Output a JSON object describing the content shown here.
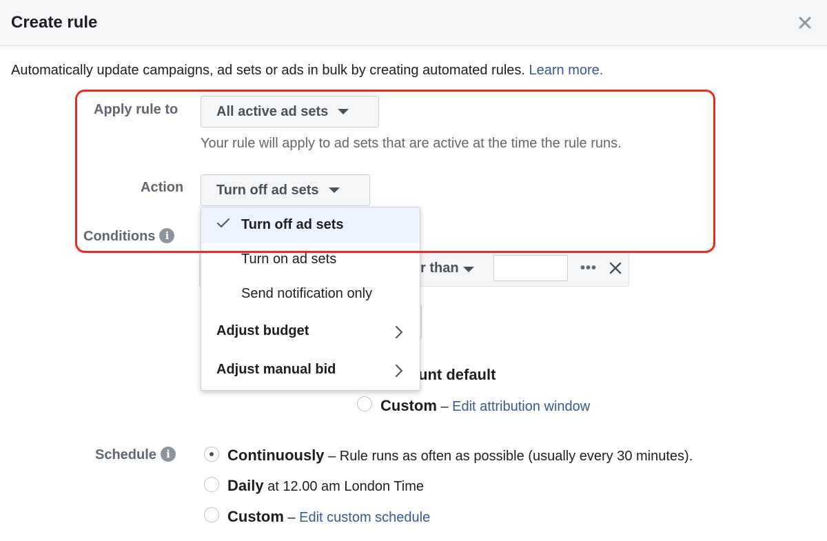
{
  "dialog": {
    "title": "Create rule",
    "intro_text": "Automatically update campaigns, ad sets or ads in bulk by creating automated rules.",
    "learn_more": "Learn more."
  },
  "apply_rule": {
    "label": "Apply rule to",
    "selected": "All active ad sets",
    "helper": "Your rule will apply to ad sets that are active at the time the rule runs."
  },
  "action": {
    "label": "Action",
    "selected": "Turn off ad sets",
    "menu": [
      {
        "label": "Turn off ad sets",
        "selected": true
      },
      {
        "label": "Turn on ad sets"
      },
      {
        "label": "Send notification only"
      },
      {
        "label": "Adjust budget",
        "submenu": true
      },
      {
        "label": "Adjust manual bid",
        "submenu": true
      }
    ]
  },
  "conditions": {
    "label": "Conditions",
    "operator_partial": "r than",
    "value": ""
  },
  "attribution": {
    "default_partial": "unt default",
    "custom_label": "Custom",
    "custom_link": "Edit attribution window"
  },
  "schedule": {
    "label": "Schedule",
    "options": [
      {
        "label": "Continuously",
        "detail": "Rule runs as often as possible (usually every 30 minutes).",
        "checked": true
      },
      {
        "label": "Daily",
        "detail": "at 12.00 am London Time",
        "checked": false
      },
      {
        "label": "Custom",
        "link": "Edit custom schedule",
        "checked": false
      }
    ]
  },
  "colors": {
    "highlight": "#f0281e",
    "link": "#385898",
    "menu_selected": "#ecf3ff"
  }
}
